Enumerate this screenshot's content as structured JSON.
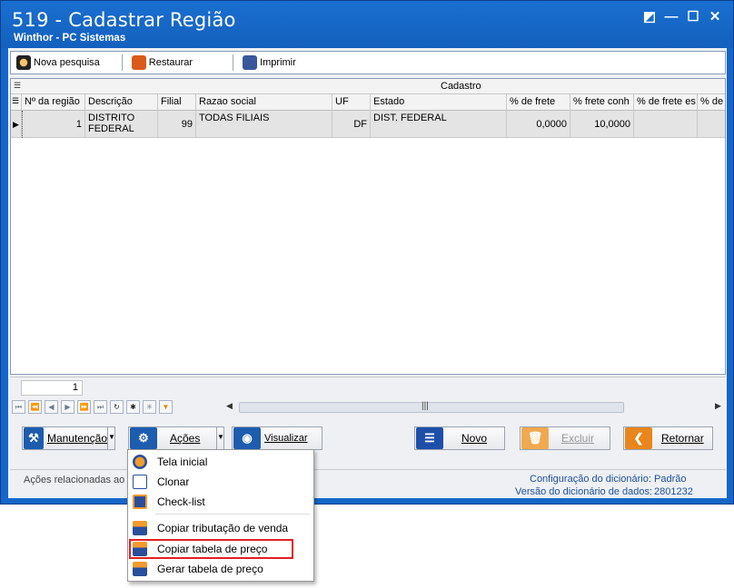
{
  "window": {
    "title": "519 - Cadastrar Região",
    "subtitle": "Winthor - PC Sistemas",
    "controls": [
      "◩",
      "—",
      "☐",
      "✕"
    ]
  },
  "toolbar": {
    "new_search": "Nova pesquisa",
    "restore": "Restaurar",
    "print": "Imprimir"
  },
  "grid": {
    "band_label": "Cadastro",
    "columns": [
      "Nº da região",
      "Descrição",
      "Filial",
      "Razao social",
      "UF",
      "Estado",
      "% de frete",
      "% frete conh",
      "% de frete es",
      "% de"
    ],
    "rows": [
      {
        "regiao": "1",
        "descricao": "DISTRITO FEDERAL",
        "filial": "99",
        "razao_social": "TODAS FILIAIS",
        "uf": "DF",
        "estado": "DIST. FEDERAL",
        "frete": "0,0000",
        "frete_conh": "10,0000",
        "frete_es": "",
        "de": ""
      }
    ],
    "footer_count": "1"
  },
  "buttons": {
    "manutencao": "Manutenção",
    "acoes": "Ações",
    "visualizar": "Visualizar",
    "novo": "Novo",
    "excluir": "Excluir",
    "retornar": "Retornar"
  },
  "status": {
    "left": "Ações relacionadas ao r",
    "config_label": "Configuração do dicionário:",
    "config_value": "Padrão",
    "version_label": "Versão do dicionário de dados:",
    "version_value": "2801232"
  },
  "menu": {
    "items": [
      "Tela inicial",
      "Clonar",
      "Check-list",
      "Copiar tributação de venda",
      "Copiar tabela de preço",
      "Gerar tabela de preço"
    ]
  }
}
